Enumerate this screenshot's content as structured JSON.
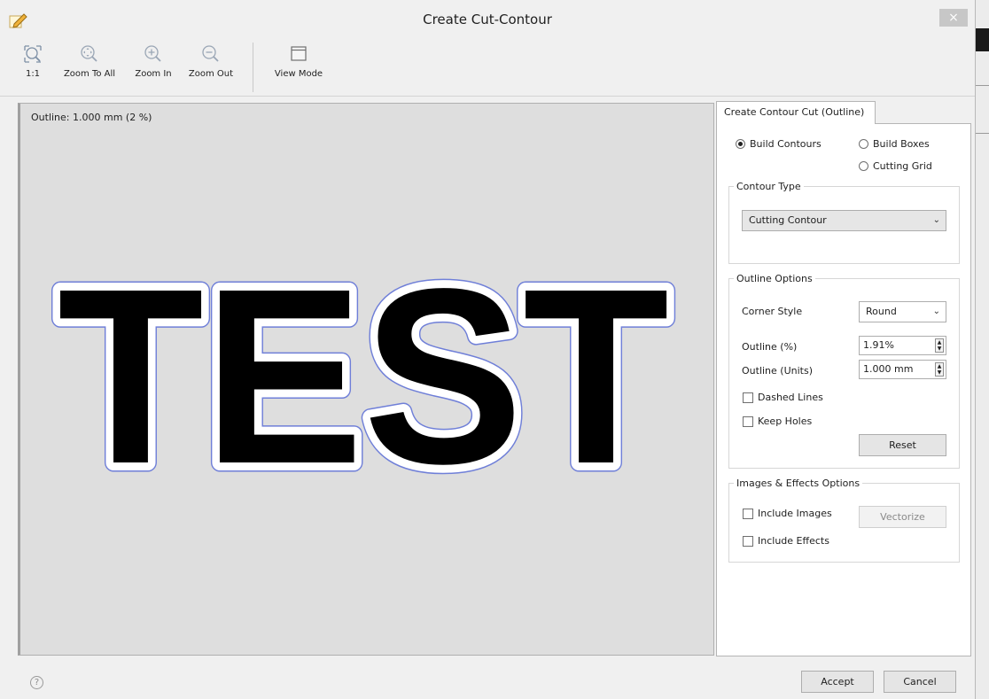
{
  "window": {
    "title": "Create Cut-Contour",
    "close_glyph": "×",
    "icon": "pencil-edit-icon"
  },
  "toolbar": {
    "items": [
      {
        "label": "1:1",
        "icon": "zoom-fit-frame-icon"
      },
      {
        "label": "Zoom To All",
        "icon": "zoom-to-all-icon"
      },
      {
        "label": "Zoom In",
        "icon": "zoom-in-icon"
      },
      {
        "label": "Zoom Out",
        "icon": "zoom-out-icon"
      },
      {
        "label": "View Mode",
        "icon": "view-mode-window-icon"
      }
    ]
  },
  "canvas": {
    "outline_readout": "Outline: 1.000 mm (2 %)",
    "preview_text": "TEST",
    "fill_color": "#000000",
    "contour_color": "#6f7fd8",
    "background_color": "#dedede"
  },
  "panel": {
    "tab_label": "Create Contour Cut (Outline)",
    "mode": {
      "build_contours": "Build Contours",
      "build_boxes": "Build Boxes",
      "cutting_grid": "Cutting Grid",
      "selected": "Build Contours"
    },
    "contour_type": {
      "legend": "Contour Type",
      "value": "Cutting Contour"
    },
    "outline_options": {
      "legend": "Outline Options",
      "corner_style_label": "Corner Style",
      "corner_style_value": "Round",
      "outline_pct_label": "Outline (%)",
      "outline_pct_value": "1.91%",
      "outline_units_label": "Outline (Units)",
      "outline_units_value": "1.000 mm",
      "dashed_lines": "Dashed Lines",
      "keep_holes": "Keep Holes",
      "reset_label": "Reset"
    },
    "images_effects": {
      "legend": "Images & Effects Options",
      "include_images": "Include Images",
      "include_effects": "Include Effects",
      "vectorize_label": "Vectorize"
    }
  },
  "footer": {
    "help_glyph": "?",
    "accept_label": "Accept",
    "cancel_label": "Cancel"
  }
}
